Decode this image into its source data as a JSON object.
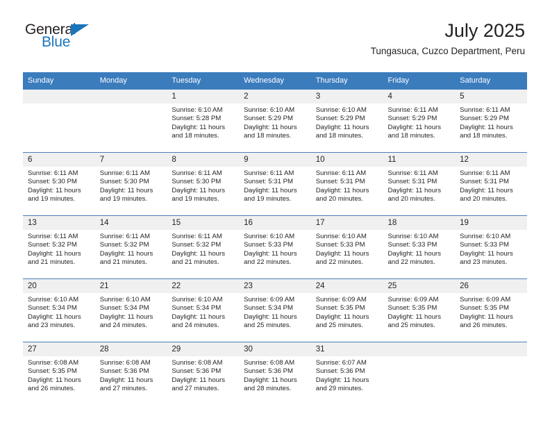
{
  "brand": {
    "name_top": "General",
    "name_bottom": "Blue",
    "accent_color": "#1b75bb"
  },
  "header": {
    "title": "July 2025",
    "subtitle": "Tungasuca, Cuzco Department, Peru"
  },
  "theme": {
    "header_row_bg": "#3b7cbd",
    "day_number_bg": "#f0f0f0",
    "row_divider": "#4a7ebb",
    "text": "#231f20"
  },
  "weekday_headers": [
    "Sunday",
    "Monday",
    "Tuesday",
    "Wednesday",
    "Thursday",
    "Friday",
    "Saturday"
  ],
  "weeks": [
    [
      {
        "day": "",
        "sunrise": "",
        "sunset": "",
        "daylight_1": "",
        "daylight_2": ""
      },
      {
        "day": "",
        "sunrise": "",
        "sunset": "",
        "daylight_1": "",
        "daylight_2": ""
      },
      {
        "day": "1",
        "sunrise": "Sunrise: 6:10 AM",
        "sunset": "Sunset: 5:28 PM",
        "daylight_1": "Daylight: 11 hours",
        "daylight_2": "and 18 minutes."
      },
      {
        "day": "2",
        "sunrise": "Sunrise: 6:10 AM",
        "sunset": "Sunset: 5:29 PM",
        "daylight_1": "Daylight: 11 hours",
        "daylight_2": "and 18 minutes."
      },
      {
        "day": "3",
        "sunrise": "Sunrise: 6:10 AM",
        "sunset": "Sunset: 5:29 PM",
        "daylight_1": "Daylight: 11 hours",
        "daylight_2": "and 18 minutes."
      },
      {
        "day": "4",
        "sunrise": "Sunrise: 6:11 AM",
        "sunset": "Sunset: 5:29 PM",
        "daylight_1": "Daylight: 11 hours",
        "daylight_2": "and 18 minutes."
      },
      {
        "day": "5",
        "sunrise": "Sunrise: 6:11 AM",
        "sunset": "Sunset: 5:29 PM",
        "daylight_1": "Daylight: 11 hours",
        "daylight_2": "and 18 minutes."
      }
    ],
    [
      {
        "day": "6",
        "sunrise": "Sunrise: 6:11 AM",
        "sunset": "Sunset: 5:30 PM",
        "daylight_1": "Daylight: 11 hours",
        "daylight_2": "and 19 minutes."
      },
      {
        "day": "7",
        "sunrise": "Sunrise: 6:11 AM",
        "sunset": "Sunset: 5:30 PM",
        "daylight_1": "Daylight: 11 hours",
        "daylight_2": "and 19 minutes."
      },
      {
        "day": "8",
        "sunrise": "Sunrise: 6:11 AM",
        "sunset": "Sunset: 5:30 PM",
        "daylight_1": "Daylight: 11 hours",
        "daylight_2": "and 19 minutes."
      },
      {
        "day": "9",
        "sunrise": "Sunrise: 6:11 AM",
        "sunset": "Sunset: 5:31 PM",
        "daylight_1": "Daylight: 11 hours",
        "daylight_2": "and 19 minutes."
      },
      {
        "day": "10",
        "sunrise": "Sunrise: 6:11 AM",
        "sunset": "Sunset: 5:31 PM",
        "daylight_1": "Daylight: 11 hours",
        "daylight_2": "and 20 minutes."
      },
      {
        "day": "11",
        "sunrise": "Sunrise: 6:11 AM",
        "sunset": "Sunset: 5:31 PM",
        "daylight_1": "Daylight: 11 hours",
        "daylight_2": "and 20 minutes."
      },
      {
        "day": "12",
        "sunrise": "Sunrise: 6:11 AM",
        "sunset": "Sunset: 5:31 PM",
        "daylight_1": "Daylight: 11 hours",
        "daylight_2": "and 20 minutes."
      }
    ],
    [
      {
        "day": "13",
        "sunrise": "Sunrise: 6:11 AM",
        "sunset": "Sunset: 5:32 PM",
        "daylight_1": "Daylight: 11 hours",
        "daylight_2": "and 21 minutes."
      },
      {
        "day": "14",
        "sunrise": "Sunrise: 6:11 AM",
        "sunset": "Sunset: 5:32 PM",
        "daylight_1": "Daylight: 11 hours",
        "daylight_2": "and 21 minutes."
      },
      {
        "day": "15",
        "sunrise": "Sunrise: 6:11 AM",
        "sunset": "Sunset: 5:32 PM",
        "daylight_1": "Daylight: 11 hours",
        "daylight_2": "and 21 minutes."
      },
      {
        "day": "16",
        "sunrise": "Sunrise: 6:10 AM",
        "sunset": "Sunset: 5:33 PM",
        "daylight_1": "Daylight: 11 hours",
        "daylight_2": "and 22 minutes."
      },
      {
        "day": "17",
        "sunrise": "Sunrise: 6:10 AM",
        "sunset": "Sunset: 5:33 PM",
        "daylight_1": "Daylight: 11 hours",
        "daylight_2": "and 22 minutes."
      },
      {
        "day": "18",
        "sunrise": "Sunrise: 6:10 AM",
        "sunset": "Sunset: 5:33 PM",
        "daylight_1": "Daylight: 11 hours",
        "daylight_2": "and 22 minutes."
      },
      {
        "day": "19",
        "sunrise": "Sunrise: 6:10 AM",
        "sunset": "Sunset: 5:33 PM",
        "daylight_1": "Daylight: 11 hours",
        "daylight_2": "and 23 minutes."
      }
    ],
    [
      {
        "day": "20",
        "sunrise": "Sunrise: 6:10 AM",
        "sunset": "Sunset: 5:34 PM",
        "daylight_1": "Daylight: 11 hours",
        "daylight_2": "and 23 minutes."
      },
      {
        "day": "21",
        "sunrise": "Sunrise: 6:10 AM",
        "sunset": "Sunset: 5:34 PM",
        "daylight_1": "Daylight: 11 hours",
        "daylight_2": "and 24 minutes."
      },
      {
        "day": "22",
        "sunrise": "Sunrise: 6:10 AM",
        "sunset": "Sunset: 5:34 PM",
        "daylight_1": "Daylight: 11 hours",
        "daylight_2": "and 24 minutes."
      },
      {
        "day": "23",
        "sunrise": "Sunrise: 6:09 AM",
        "sunset": "Sunset: 5:34 PM",
        "daylight_1": "Daylight: 11 hours",
        "daylight_2": "and 25 minutes."
      },
      {
        "day": "24",
        "sunrise": "Sunrise: 6:09 AM",
        "sunset": "Sunset: 5:35 PM",
        "daylight_1": "Daylight: 11 hours",
        "daylight_2": "and 25 minutes."
      },
      {
        "day": "25",
        "sunrise": "Sunrise: 6:09 AM",
        "sunset": "Sunset: 5:35 PM",
        "daylight_1": "Daylight: 11 hours",
        "daylight_2": "and 25 minutes."
      },
      {
        "day": "26",
        "sunrise": "Sunrise: 6:09 AM",
        "sunset": "Sunset: 5:35 PM",
        "daylight_1": "Daylight: 11 hours",
        "daylight_2": "and 26 minutes."
      }
    ],
    [
      {
        "day": "27",
        "sunrise": "Sunrise: 6:08 AM",
        "sunset": "Sunset: 5:35 PM",
        "daylight_1": "Daylight: 11 hours",
        "daylight_2": "and 26 minutes."
      },
      {
        "day": "28",
        "sunrise": "Sunrise: 6:08 AM",
        "sunset": "Sunset: 5:36 PM",
        "daylight_1": "Daylight: 11 hours",
        "daylight_2": "and 27 minutes."
      },
      {
        "day": "29",
        "sunrise": "Sunrise: 6:08 AM",
        "sunset": "Sunset: 5:36 PM",
        "daylight_1": "Daylight: 11 hours",
        "daylight_2": "and 27 minutes."
      },
      {
        "day": "30",
        "sunrise": "Sunrise: 6:08 AM",
        "sunset": "Sunset: 5:36 PM",
        "daylight_1": "Daylight: 11 hours",
        "daylight_2": "and 28 minutes."
      },
      {
        "day": "31",
        "sunrise": "Sunrise: 6:07 AM",
        "sunset": "Sunset: 5:36 PM",
        "daylight_1": "Daylight: 11 hours",
        "daylight_2": "and 29 minutes."
      },
      {
        "day": "",
        "sunrise": "",
        "sunset": "",
        "daylight_1": "",
        "daylight_2": ""
      },
      {
        "day": "",
        "sunrise": "",
        "sunset": "",
        "daylight_1": "",
        "daylight_2": ""
      }
    ]
  ]
}
